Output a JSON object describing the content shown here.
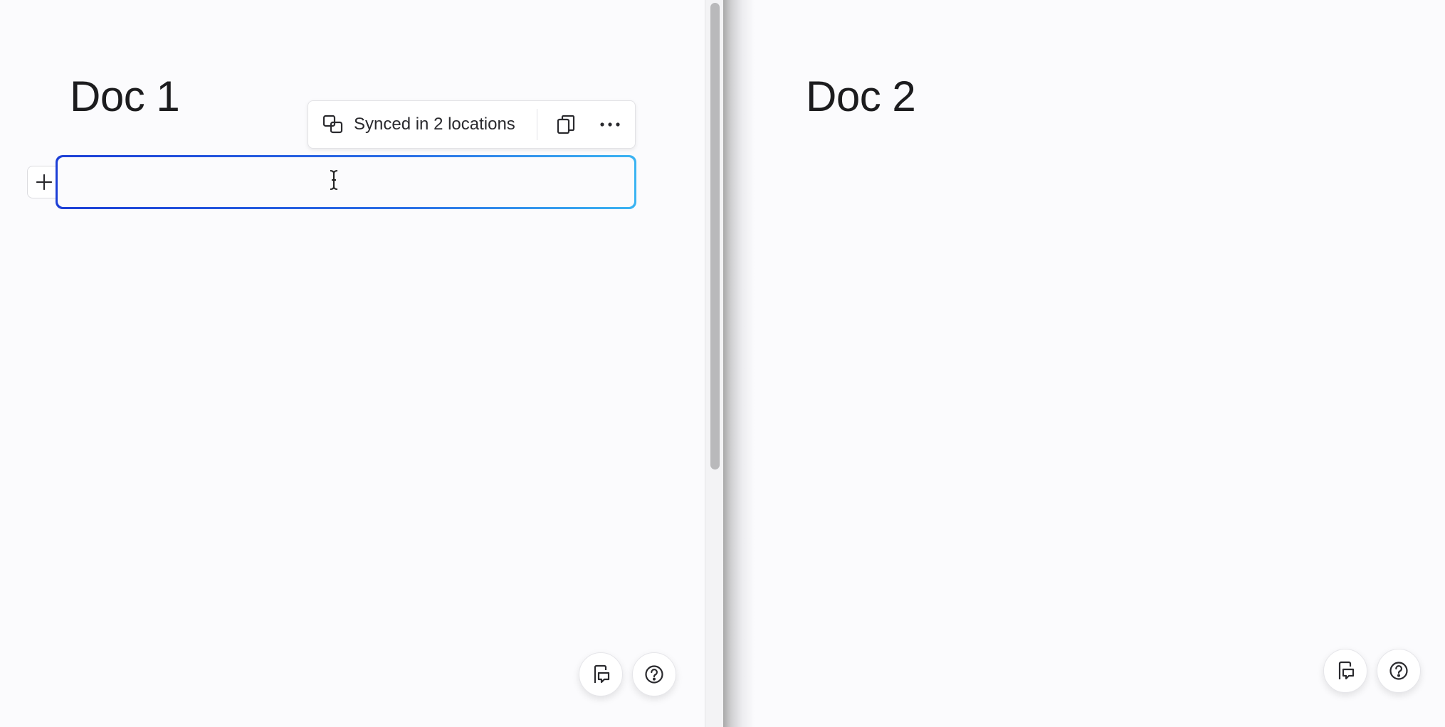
{
  "left_doc": {
    "title": "Doc 1",
    "sync_toolbar": {
      "status_label": "Synced in 2 locations",
      "status_icon": "synced-block-icon",
      "copy_icon": "copy-icon",
      "more_icon": "more-horizontal-icon"
    },
    "add_block_icon": "plus-icon",
    "feedback_icon": "feedback-icon",
    "help_icon": "help-icon"
  },
  "right_doc": {
    "title": "Doc 2",
    "feedback_icon": "feedback-icon",
    "help_icon": "help-icon"
  },
  "colors": {
    "accent_gradient_start": "#1d3fd6",
    "accent_gradient_end": "#3bb4f2",
    "background": "#fbfbfd",
    "text": "#1c1c1e"
  }
}
